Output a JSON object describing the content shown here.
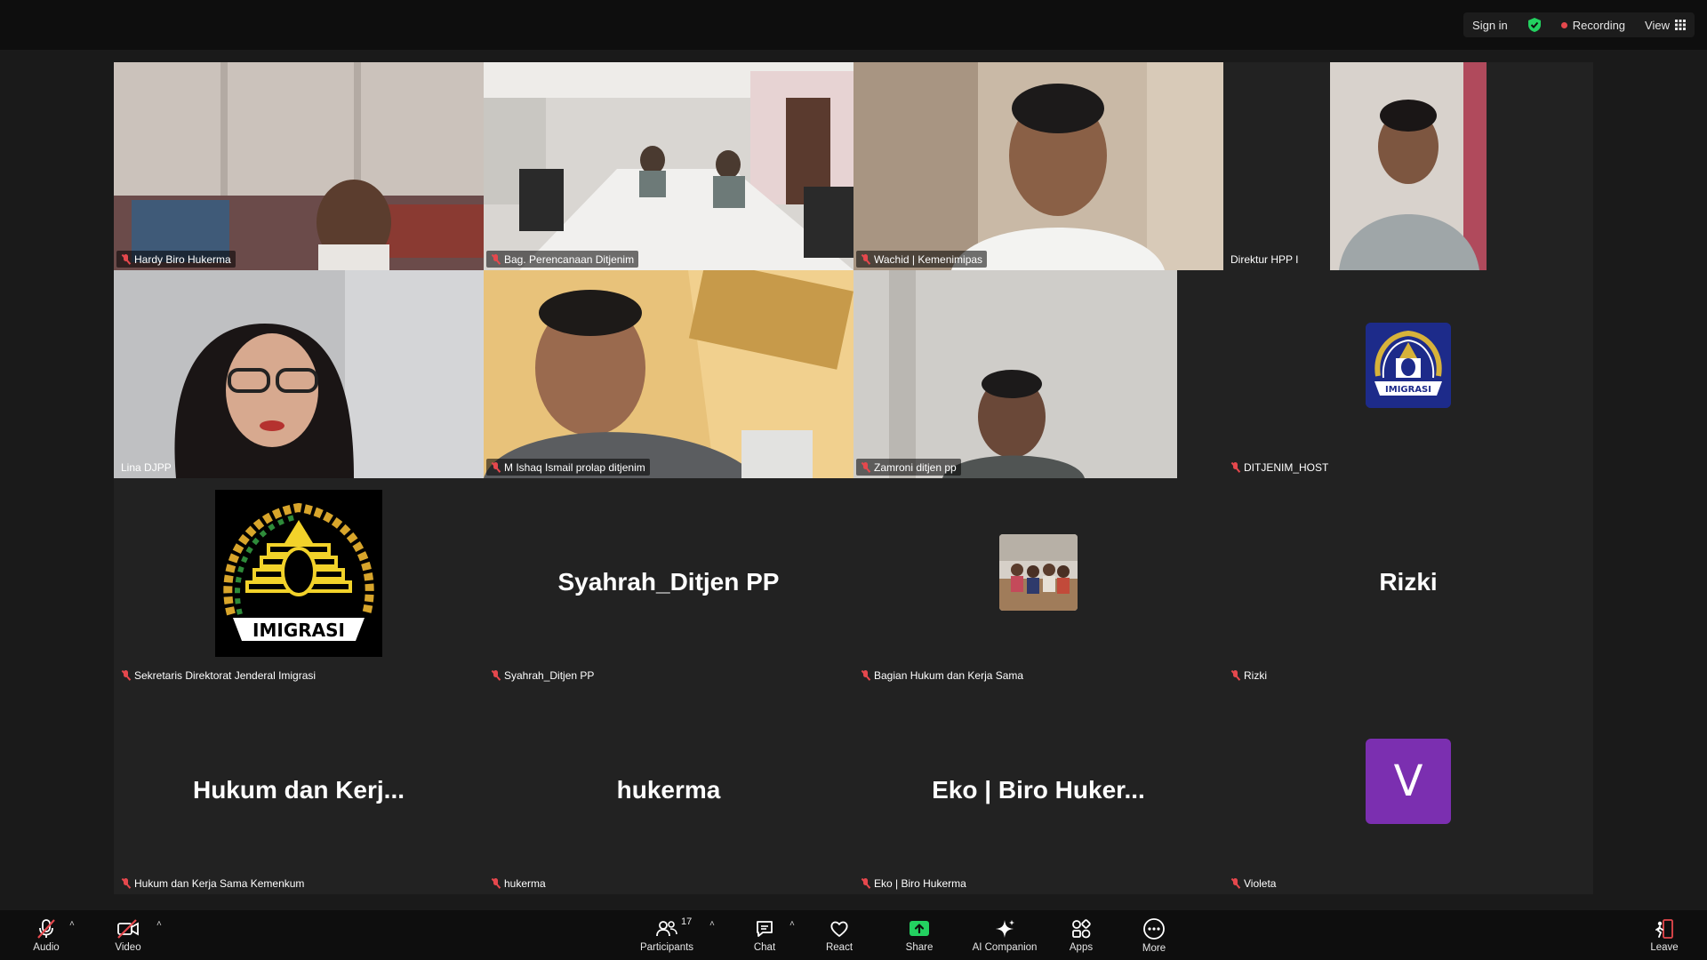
{
  "topbar": {
    "sign_in": "Sign in",
    "recording": "Recording",
    "view": "View",
    "colors": {
      "shield": "#23d160",
      "record_dot": "#e5484d"
    }
  },
  "tiles": [
    {
      "name": "Hardy Biro Hukerma",
      "muted": true,
      "kind": "video"
    },
    {
      "name": "Bag. Perencanaan Ditjenim",
      "muted": true,
      "kind": "video"
    },
    {
      "name": "Wachid | Kemenimipas",
      "muted": true,
      "kind": "video"
    },
    {
      "name": "Direktur HPP I",
      "muted": false,
      "kind": "video",
      "active_speaker": true
    },
    {
      "name": "Lina DJPP",
      "muted": false,
      "kind": "video"
    },
    {
      "name": "M Ishaq Ismail prolap ditjenim",
      "muted": true,
      "kind": "video"
    },
    {
      "name": "Zamroni ditjen pp",
      "muted": true,
      "kind": "video"
    },
    {
      "name": "DITJENIM_HOST",
      "muted": true,
      "kind": "emblem",
      "emblem_text": "IMIGRASI"
    },
    {
      "name": "Sekretaris Direktorat Jenderal Imigrasi",
      "muted": true,
      "kind": "emblem",
      "emblem_text": "IMIGRASI"
    },
    {
      "name": "Syahrah_Ditjen PP",
      "muted": true,
      "kind": "name",
      "display": "Syahrah_Ditjen PP"
    },
    {
      "name": "Bagian Hukum dan Kerja Sama",
      "muted": true,
      "kind": "photo"
    },
    {
      "name": "Rizki",
      "muted": true,
      "kind": "name",
      "display": "Rizki"
    },
    {
      "name": "Hukum dan Kerja Sama Kemenkum",
      "muted": true,
      "kind": "name",
      "display": "Hukum dan Kerj..."
    },
    {
      "name": "hukerma",
      "muted": true,
      "kind": "name",
      "display": "hukerma"
    },
    {
      "name": "Eko | Biro Hukerma",
      "muted": true,
      "kind": "name",
      "display": "Eko | Biro Huker..."
    },
    {
      "name": "Violeta",
      "muted": true,
      "kind": "avatar",
      "initial": "V",
      "avatar_color": "#7b2fb0"
    }
  ],
  "toolbar": {
    "audio": "Audio",
    "video": "Video",
    "participants": "Participants",
    "participants_count": "17",
    "chat": "Chat",
    "react": "React",
    "share": "Share",
    "ai_companion": "AI Companion",
    "apps": "Apps",
    "more": "More",
    "leave": "Leave",
    "colors": {
      "share": "#23d160",
      "muted_red": "#e5484d"
    }
  }
}
